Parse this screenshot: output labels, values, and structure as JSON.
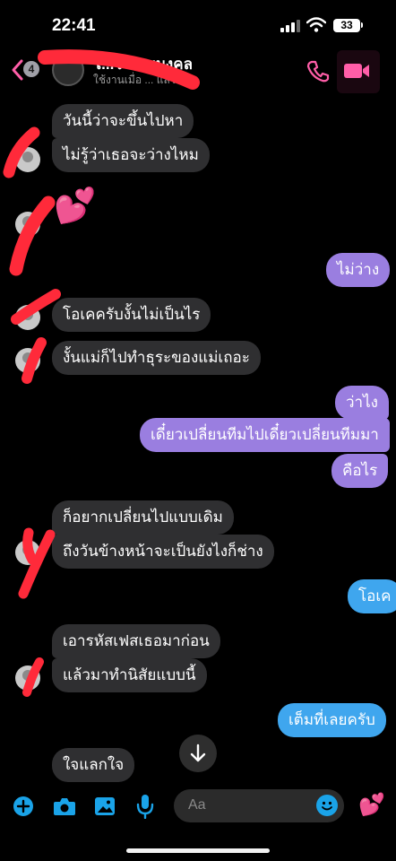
{
  "status_bar": {
    "time": "22:41",
    "battery": "33"
  },
  "header": {
    "back_badge": "4",
    "contact_name": "โ...โ ชอบมงคล",
    "contact_status": "ใช้งานเมื่อ ... แล้ว",
    "call_icon": "phone-icon",
    "video_icon": "video-camera-icon"
  },
  "colors": {
    "incoming_bubble": "#2f2f31",
    "outgoing_purple": "#9a7ee0",
    "outgoing_blue": "#3fa6ee",
    "accent_pink": "#ff5ea8",
    "accent_blue": "#1aa3e8",
    "scribble_red": "#ff2a3a"
  },
  "messages": [
    {
      "text": "วันนี้ว่าจะขึ้นไปหา"
    },
    {
      "text": "ไม่รู้ว่าเธอจะว่างไหม"
    },
    {
      "text": "💕"
    },
    {
      "text": "ไม่ว่าง"
    },
    {
      "text": "โอเคครับงั้นไม่เป็นไร"
    },
    {
      "text": "งั้นแม่ก็ไปทำธุระของแม่เถอะ"
    },
    {
      "text": "ว่าไง"
    },
    {
      "text": "เดี๋ยวเปลี่ยนทีมไปเดี๋ยวเปลี่ยนทีมมา"
    },
    {
      "text": "คือไร"
    },
    {
      "text": "ก็อยากเปลี่ยนไปแบบเดิม"
    },
    {
      "text": "ถึงวันข้างหน้าจะเป็นยังไงก็ช่าง"
    },
    {
      "text": "โอเค"
    },
    {
      "text": "เอารหัสเฟสเธอมาก่อน"
    },
    {
      "text": "แล้วมาทำนิสัยแบบนี้"
    },
    {
      "text": "เต็มที่เลยครับ"
    },
    {
      "text": "ใจแลกใจ"
    }
  ],
  "composer": {
    "placeholder": "Aa",
    "icons": [
      "plus-icon",
      "camera-icon",
      "gallery-icon",
      "microphone-icon",
      "emoji-icon",
      "heart-sticker-icon"
    ],
    "reaction": "💕"
  }
}
